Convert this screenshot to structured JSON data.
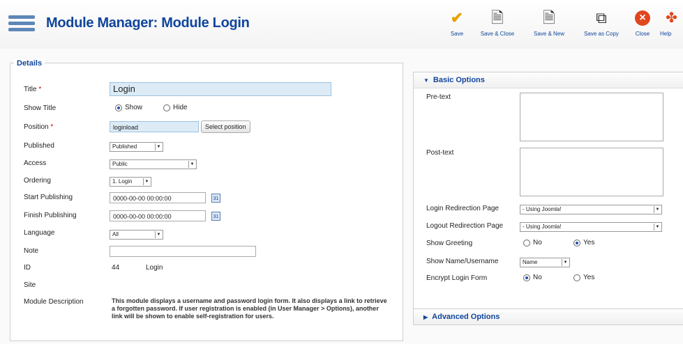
{
  "header": {
    "title": "Module Manager: Module Login",
    "buttons": [
      {
        "label": "Save",
        "icon": "checkmark-icon"
      },
      {
        "label": "Save & Close",
        "icon": "save-icon"
      },
      {
        "label": "Save & New",
        "icon": "save-new-icon"
      },
      {
        "label": "Save as Copy",
        "icon": "copy-icon"
      },
      {
        "label": "Close",
        "icon": "close-icon"
      },
      {
        "label": "Help",
        "icon": "help-icon"
      }
    ]
  },
  "details": {
    "legend": "Details",
    "title_label": "Title",
    "required_mark": "*",
    "title_value": "Login",
    "show_title_label": "Show Title",
    "show_label": "Show",
    "hide_label": "Hide",
    "show_title_value": "Show",
    "position_label": "Position",
    "position_value": "loginload",
    "select_position": "Select position",
    "published_label": "Published",
    "published_value": "Published",
    "access_label": "Access",
    "access_value": "Public",
    "ordering_label": "Ordering",
    "ordering_value": "1. Login",
    "start_label": "Start Publishing",
    "start_value": "0000-00-00 00:00:00",
    "finish_label": "Finish Publishing",
    "finish_value": "0000-00-00 00:00:00",
    "calendar_glyph": "31",
    "language_label": "Language",
    "language_value": "All",
    "note_label": "Note",
    "note_value": "",
    "id_label": "ID",
    "id_value": "44",
    "id_name": "Login",
    "site_label": "Site",
    "description_label": "Module Description",
    "description": "This module displays a username and password login form. It also displays a link to retrieve a forgotten password. If user registration is enabled (in User Manager > Options), another link will be shown to enable self-registration for users."
  },
  "basic_options": {
    "title": "Basic Options",
    "pretext_label": "Pre-text",
    "posttext_label": "Post-text",
    "login_redirect_label": "Login Redirection Page",
    "login_redirect_value": "- Using Joomla!",
    "logout_redirect_label": "Logout Redirection Page",
    "logout_redirect_value": "- Using Joomla!",
    "show_greeting_label": "Show Greeting",
    "no_label": "No",
    "yes_label": "Yes",
    "show_greeting_value": "Yes",
    "show_name_label": "Show Name/Username",
    "show_name_value": "Name",
    "encrypt_label": "Encrypt Login Form",
    "encrypt_value": "No"
  },
  "advanced_options": {
    "title": "Advanced Options"
  },
  "colors": {
    "accent": "#10459c",
    "field_highlight": "#dcebf6",
    "save_icon": "#e8a100",
    "close_icon": "#e2461d"
  }
}
